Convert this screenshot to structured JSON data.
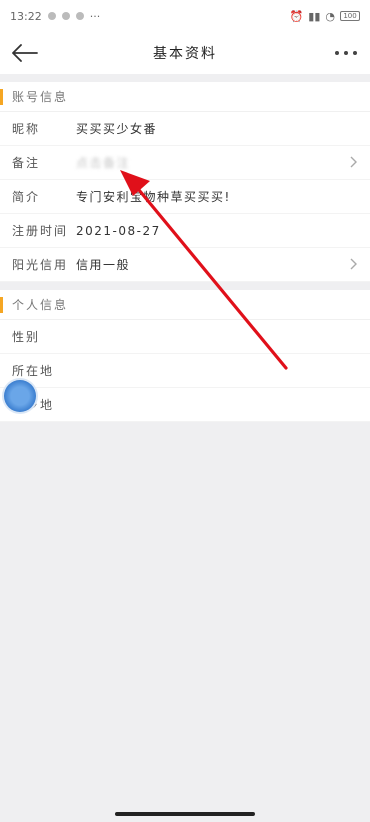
{
  "status_bar": {
    "time": "13:22",
    "battery": "100"
  },
  "header": {
    "title": "基本资料"
  },
  "account_section": {
    "title": "账号信息",
    "rows": [
      {
        "label": "昵称",
        "value": "买买买少女番"
      },
      {
        "label": "备注",
        "value": "点击备注"
      },
      {
        "label": "简介",
        "value": "专门安利宝物种草买买买!"
      },
      {
        "label": "注册时间",
        "value": "2021-08-27"
      },
      {
        "label": "阳光信用",
        "value": "信用一般"
      }
    ]
  },
  "personal_section": {
    "title": "个人信息",
    "rows": [
      {
        "label": "性别",
        "value": ""
      },
      {
        "label": "所在地",
        "value": ""
      },
      {
        "label": "家乡地",
        "value": ""
      }
    ]
  },
  "colors": {
    "accent": "#f5a623",
    "annotation_arrow": "#e0101a",
    "floating_ball": "#3c7fd0"
  }
}
